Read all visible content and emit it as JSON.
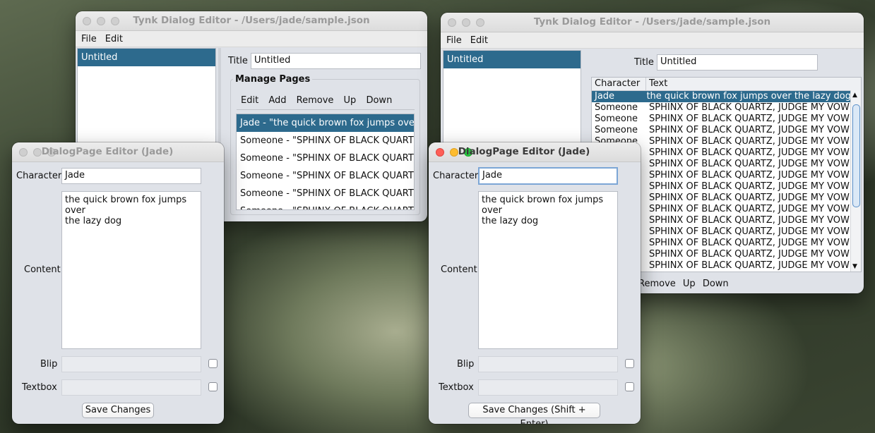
{
  "main_window": {
    "title": "Tynk Dialog Editor - /Users/jade/sample.json",
    "menu": [
      "File",
      "Edit"
    ],
    "sidebar": {
      "items": [
        {
          "label": "Untitled"
        }
      ]
    },
    "title_label": "Title",
    "title_value": "Untitled",
    "manage_pages": {
      "legend": "Manage Pages",
      "toolbar": [
        "Edit",
        "Add",
        "Remove",
        "Up",
        "Down"
      ],
      "pages": [
        "Jade - \"the quick brown fox jumps over...",
        "Someone - \"SPHINX OF BLACK QUARTZ,...",
        "Someone - \"SPHINX OF BLACK QUARTZ,...",
        "Someone - \"SPHINX OF BLACK QUARTZ,...",
        "Someone - \"SPHINX OF BLACK QUARTZ,...",
        "Someone - \"SPHINX OF BLACK QUARTZ,..."
      ]
    }
  },
  "right_window": {
    "title": "Tynk Dialog Editor - /Users/jade/sample.json",
    "menu": [
      "File",
      "Edit"
    ],
    "sidebar": {
      "items": [
        {
          "label": "Untitled"
        }
      ]
    },
    "title_label": "Title",
    "title_value": "Untitled",
    "table": {
      "headers": [
        "Character",
        "Text"
      ],
      "rows": [
        [
          "Jade",
          "the quick brown fox jumps over the lazy dog"
        ],
        [
          "Someone",
          "SPHINX OF BLACK QUARTZ, JUDGE MY VOW"
        ],
        [
          "Someone",
          "SPHINX OF BLACK QUARTZ, JUDGE MY VOW"
        ],
        [
          "Someone",
          "SPHINX OF BLACK QUARTZ, JUDGE MY VOW"
        ],
        [
          "Someone",
          "SPHINX OF BLACK QUARTZ, JUDGE MY VOW"
        ],
        [
          "",
          "SPHINX OF BLACK QUARTZ, JUDGE MY VOW"
        ],
        [
          "",
          "SPHINX OF BLACK QUARTZ, JUDGE MY VOW"
        ],
        [
          "",
          "SPHINX OF BLACK QUARTZ, JUDGE MY VOW"
        ],
        [
          "",
          "SPHINX OF BLACK QUARTZ, JUDGE MY VOW"
        ],
        [
          "",
          "SPHINX OF BLACK QUARTZ, JUDGE MY VOW"
        ],
        [
          "",
          "SPHINX OF BLACK QUARTZ, JUDGE MY VOW"
        ],
        [
          "",
          "SPHINX OF BLACK QUARTZ, JUDGE MY VOW"
        ],
        [
          "",
          "SPHINX OF BLACK QUARTZ, JUDGE MY VOW"
        ],
        [
          "",
          "SPHINX OF BLACK QUARTZ, JUDGE MY VOW"
        ],
        [
          "",
          "SPHINX OF BLACK QUARTZ, JUDGE MY VOW"
        ],
        [
          "",
          "SPHINX OF BLACK QUARTZ, JUDGE MY VOW"
        ]
      ]
    },
    "toolbar_visible": [
      "Remove",
      "Up",
      "Down"
    ]
  },
  "left_dialog": {
    "title": "DialogPage Editor (Jade)",
    "character_label": "Character",
    "character_value": "Jade",
    "content_label": "Content",
    "content_value": "the quick brown fox jumps over\nthe lazy dog",
    "blip_label": "Blip",
    "textbox_label": "Textbox",
    "save_label": "Save Changes"
  },
  "right_dialog": {
    "title": "DialogPage Editor (Jade)",
    "character_label": "Character",
    "character_value": "Jade",
    "content_label": "Content",
    "content_value": "the quick brown fox jumps over\nthe lazy dog",
    "blip_label": "Blip",
    "textbox_label": "Textbox",
    "save_label": "Save Changes (Shift + Enter)"
  },
  "colors": {
    "selection": "#2d6a8d",
    "traffic_red": "#fe5f57",
    "traffic_yellow": "#febc2e",
    "traffic_green": "#28c840"
  }
}
